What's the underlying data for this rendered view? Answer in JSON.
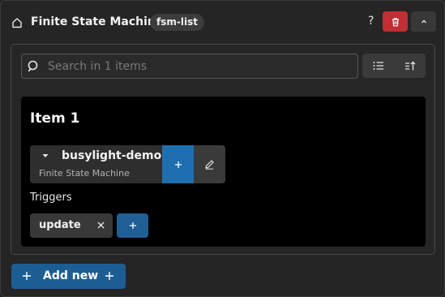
{
  "header": {
    "icon": "home-icon",
    "title": "Finite State Machine",
    "tag": "fsm-list",
    "help_text": "?",
    "delete_icon": "trash-icon",
    "collapse_icon": "chevron-up-icon",
    "delete_color": "#c32d34"
  },
  "search": {
    "icon": "search-icon",
    "placeholder": "Search in 1 items",
    "value": ""
  },
  "view_controls": {
    "list_icon": "list-icon",
    "sort_icon": "sort-icon"
  },
  "item": {
    "title": "Item 1",
    "fsm": {
      "caret_icon": "caret-down-icon",
      "name": "busylight-demo",
      "type_label": "Finite State Machine",
      "add_icon": "plus-icon",
      "edit_icon": "pencil-icon"
    },
    "triggers_label": "Triggers",
    "triggers": [
      {
        "label": "update"
      }
    ],
    "add_trigger_icon": "plus-icon"
  },
  "add_new": {
    "label": "Add new",
    "icon": "plus-icon",
    "color": "#1c5e94"
  },
  "colors": {
    "accent": "#1f6fb0",
    "danger": "#c32d34",
    "background": "#252525",
    "card": "#000000"
  }
}
